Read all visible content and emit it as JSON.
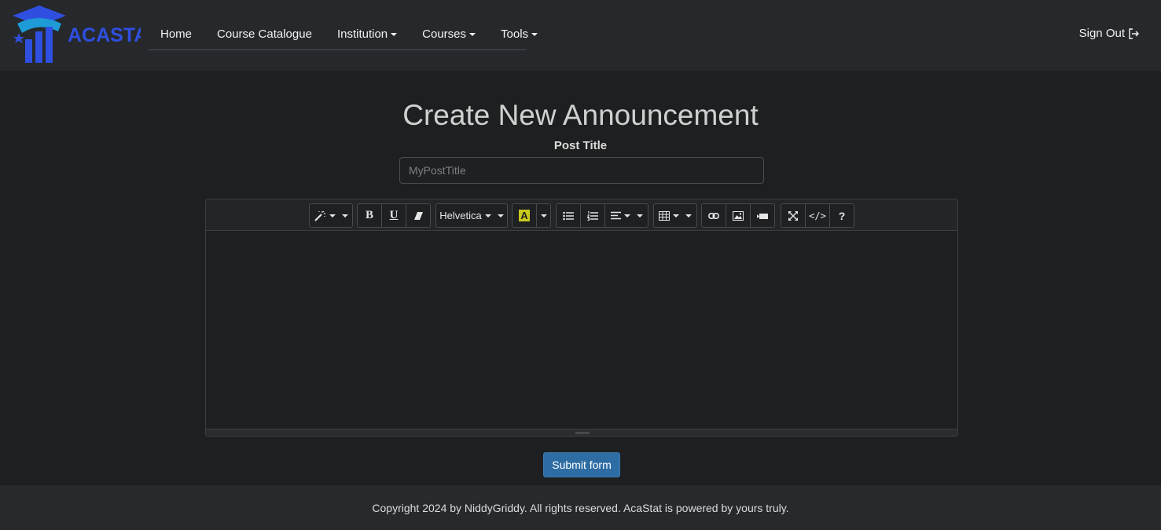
{
  "brand": {
    "logo_text": "ACASTAT",
    "logo_color": "#2f4fe0",
    "logo_accent": "#1e9bd7"
  },
  "nav": {
    "items": [
      {
        "label": "Home",
        "dropdown": false
      },
      {
        "label": "Course Catalogue",
        "dropdown": false
      },
      {
        "label": "Institution",
        "dropdown": true
      },
      {
        "label": "Courses",
        "dropdown": true
      },
      {
        "label": "Tools",
        "dropdown": true
      }
    ],
    "signout_label": "Sign Out"
  },
  "page": {
    "title": "Create New Announcement",
    "post_title_label": "Post Title",
    "post_title_placeholder": "MyPostTitle",
    "post_title_value": ""
  },
  "editor": {
    "font_name": "Helvetica",
    "toolbar_icons": [
      "magic-style-icon",
      "bold-icon",
      "underline-icon",
      "eraser-icon",
      "font-family-dropdown",
      "text-color-icon",
      "unordered-list-icon",
      "ordered-list-icon",
      "paragraph-align-icon",
      "table-icon",
      "link-icon",
      "picture-icon",
      "video-icon",
      "fullscreen-icon",
      "code-view-icon",
      "help-icon"
    ],
    "text_color_highlight": "#c9c91a",
    "content": ""
  },
  "submit_label": "Submit form",
  "accent_color": "#2e6da4",
  "footer": {
    "text": "Copyright 2024 by NiddyGriddy. All rights reserved. AcaStat is powered by yours truly."
  }
}
